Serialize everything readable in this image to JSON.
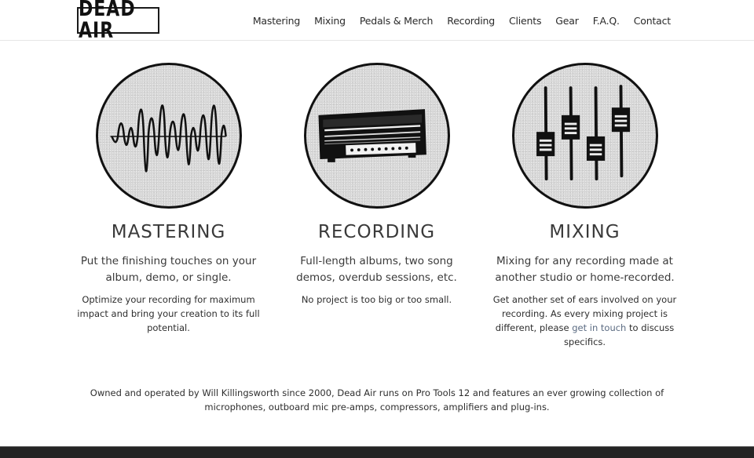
{
  "brand": {
    "logo_text": "DEAD AIR"
  },
  "nav": {
    "items": [
      {
        "label": "Mastering"
      },
      {
        "label": "Mixing"
      },
      {
        "label": "Pedals & Merch"
      },
      {
        "label": "Recording"
      },
      {
        "label": "Clients"
      },
      {
        "label": "Gear"
      },
      {
        "label": "F.A.Q."
      },
      {
        "label": "Contact"
      }
    ]
  },
  "services": [
    {
      "icon": "waveform-icon",
      "title": "MASTERING",
      "subtitle": "Put the finishing touches on your album, demo, or single.",
      "description": "Optimize your recording for maximum impact and bring your creation to its full potential."
    },
    {
      "icon": "amplifier-head-icon",
      "title": "RECORDING",
      "subtitle": "Full-length albums, two song demos, overdub sessions, etc.",
      "description": "No project is too big or too small."
    },
    {
      "icon": "mixer-faders-icon",
      "title": "MIXING",
      "subtitle": "Mixing for any recording made at another studio or home-recorded.",
      "description_before": "Get another set of ears involved on your recording. As every mixing project is different, please ",
      "link_text": "get in touch",
      "description_after": " to discuss specifics."
    }
  ],
  "about": {
    "text": "Owned and operated by Will Killingsworth since 2000, Dead Air runs on Pro Tools 12 and features an ever growing collection of microphones, outboard mic pre-amps, compressors, amplifiers and plug-ins."
  },
  "colors": {
    "link": "#5b6b82",
    "footer": "#242424",
    "text": "#333333"
  }
}
